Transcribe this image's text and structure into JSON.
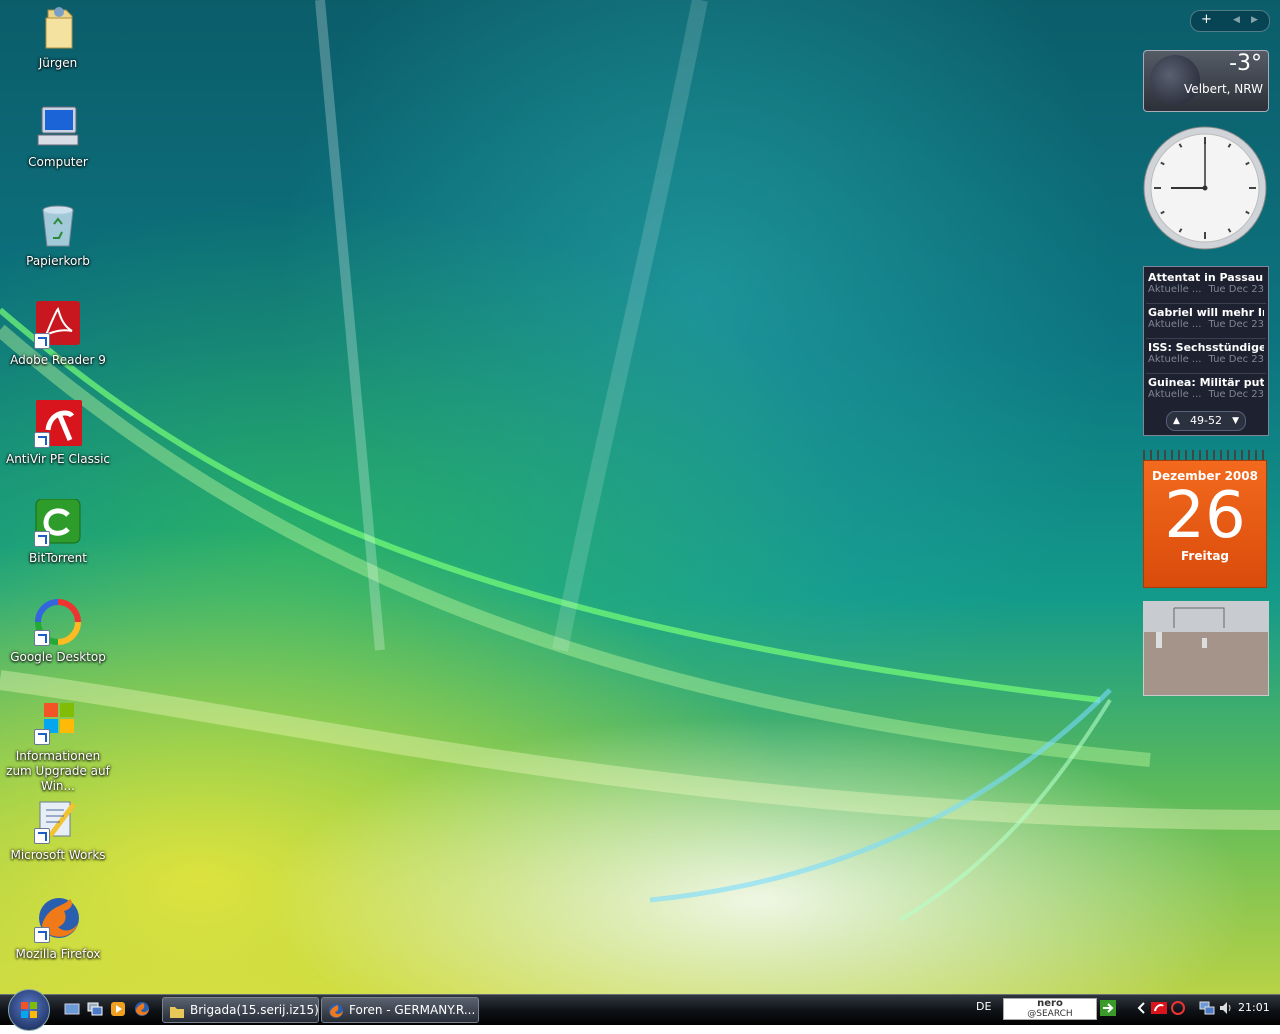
{
  "desktop": {
    "icons": [
      {
        "label": "Jürgen",
        "icon": "user-folder-icon"
      },
      {
        "label": "Computer",
        "icon": "computer-icon"
      },
      {
        "label": "Papierkorb",
        "icon": "recycle-bin-icon"
      },
      {
        "label": "Adobe Reader 9",
        "icon": "adobe-reader-icon"
      },
      {
        "label": "AntiVir PE Classic",
        "icon": "antivir-icon"
      },
      {
        "label": "BitTorrent",
        "icon": "bittorrent-icon"
      },
      {
        "label": "Google Desktop",
        "icon": "google-desktop-icon"
      },
      {
        "label": "Informationen zum Upgrade auf Win...",
        "icon": "windows-upgrade-icon"
      },
      {
        "label": "Microsoft Works",
        "icon": "microsoft-works-icon"
      },
      {
        "label": "Mozilla Firefox",
        "icon": "firefox-icon"
      }
    ]
  },
  "sidebar": {
    "controls": {
      "add": "+",
      "prev": "◀",
      "next": "▶"
    },
    "weather": {
      "temperature": "-3°",
      "location": "Velbert, NRW"
    },
    "clock": {
      "hour": 9,
      "minute": 0
    },
    "feeds": {
      "items": [
        {
          "title": "Attentat in Passau: V...",
          "source": "Aktuelle ...",
          "date": "Tue Dec 23"
        },
        {
          "title": "Gabriel will mehr Inv...",
          "source": "Aktuelle ...",
          "date": "Tue Dec 23"
        },
        {
          "title": "ISS: Sechsstündiger ...",
          "source": "Aktuelle ...",
          "date": "Tue Dec 23"
        },
        {
          "title": "Guinea: Militär putsc...",
          "source": "Aktuelle ...",
          "date": "Tue Dec 23"
        }
      ],
      "range": "49-52"
    },
    "calendar": {
      "month": "Dezember 2008",
      "day": "26",
      "weekday": "Freitag"
    }
  },
  "taskbar": {
    "tasks": [
      {
        "label": "Brigada(15.serij.iz15)...",
        "icon": "folder-icon"
      },
      {
        "label": "Foren - GERMANY.R...",
        "icon": "firefox-icon"
      }
    ],
    "language": "DE",
    "nero": {
      "line1": "nero",
      "line2": "@SEARCH"
    },
    "time": "21:01"
  },
  "colors": {
    "calendar": "#e8560f",
    "taskbar": "#101418"
  }
}
